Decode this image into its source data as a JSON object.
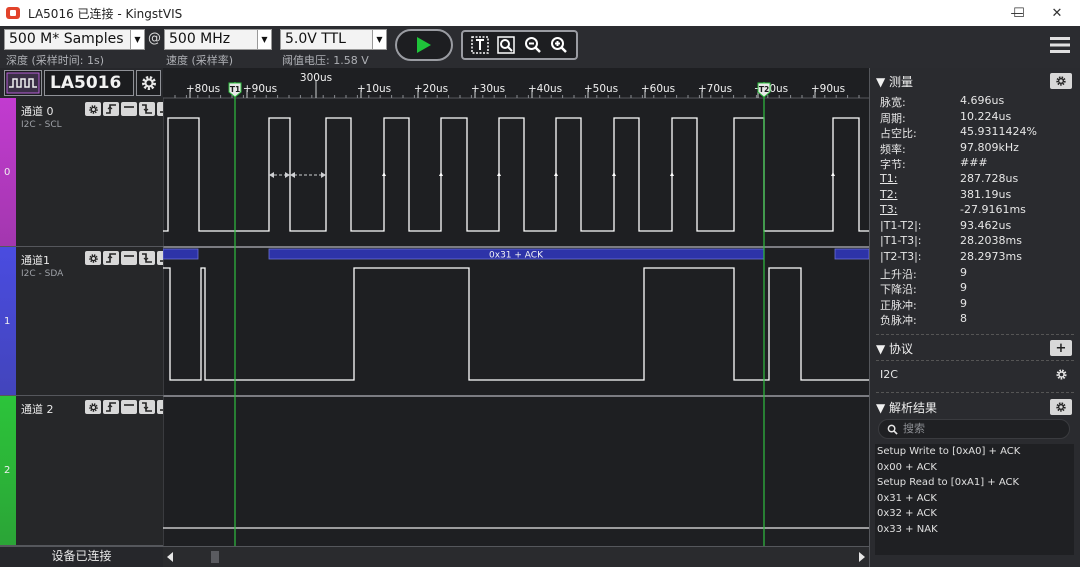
{
  "window": {
    "title": "LA5016 已连接 - KingstVIS",
    "minimize_icon": "—",
    "maximize_icon": "☐",
    "close_icon": "✕"
  },
  "toolbar": {
    "depth_value": "500 M* Samples",
    "depth_caption": "深度 (采样时间: 1s)",
    "at_symbol": "@",
    "rate_value": "500 MHz",
    "rate_caption": "速度 (采样率)",
    "threshold_value": "5.0V TTL",
    "threshold_caption": "阈值电压: 1.58 V",
    "dropdown_arrow": "▼"
  },
  "device": {
    "name": "LA5016",
    "arrow": "▼",
    "status": "设备已连接"
  },
  "channels": [
    {
      "label": "通道 0",
      "protocol": "I2C - SCL",
      "index": "0",
      "color": "#c23bd0"
    },
    {
      "label": "通道1",
      "protocol": "I2C - SDA",
      "index": "1",
      "color": "#4a4ce0"
    },
    {
      "label": "通道 2",
      "protocol": "",
      "index": "2",
      "color": "#2cc43a"
    }
  ],
  "timeline": {
    "ticks": [
      "+80us",
      "+90us",
      "300us",
      "+10us",
      "+20us",
      "+30us",
      "+40us",
      "+50us",
      "+60us",
      "+70us",
      "+80us",
      "+90us"
    ],
    "cursor1": "T1",
    "cursor2": "T2"
  },
  "decode": {
    "annotation": "0x31 + ACK"
  },
  "measure": {
    "header": "测量",
    "rows": [
      {
        "k": "脉宽:",
        "v": "4.696us",
        "ul": false
      },
      {
        "k": "周期:",
        "v": "10.224us",
        "ul": false
      },
      {
        "k": "占空比:",
        "v": "45.9311424%",
        "ul": false
      },
      {
        "k": "频率:",
        "v": "97.809kHz",
        "ul": false
      },
      {
        "k": "字节:",
        "v": "###",
        "ul": false
      },
      {
        "k": "T1:",
        "v": "287.728us",
        "ul": true
      },
      {
        "k": "T2:",
        "v": "381.19us",
        "ul": true
      },
      {
        "k": "T3:",
        "v": "-27.9161ms",
        "ul": true
      },
      {
        "k": "|T1-T2|:",
        "v": "93.462us",
        "ul": false
      },
      {
        "k": "|T1-T3|:",
        "v": "28.2038ms",
        "ul": false
      },
      {
        "k": "|T2-T3|:",
        "v": "28.2973ms",
        "ul": false
      },
      {
        "k": "上升沿:",
        "v": "9",
        "ul": false
      },
      {
        "k": "下降沿:",
        "v": "9",
        "ul": false
      },
      {
        "k": "正脉冲:",
        "v": "9",
        "ul": false
      },
      {
        "k": "负脉冲:",
        "v": "8",
        "ul": false
      }
    ]
  },
  "protocol": {
    "header": "协议",
    "add": "+",
    "item": "I2C"
  },
  "results": {
    "header": "解析结果",
    "search_placeholder": "搜索",
    "items": [
      "Setup Write to [0xA0] + ACK",
      "0x00 + ACK",
      "Setup Read to [0xA1] + ACK",
      "0x31 + ACK",
      "0x32 + ACK",
      "0x33 + NAK"
    ]
  },
  "colors": {
    "run_green": "#1fc43a",
    "cursor": "#2fbf3f",
    "decode_bar": "#2d33a8"
  }
}
